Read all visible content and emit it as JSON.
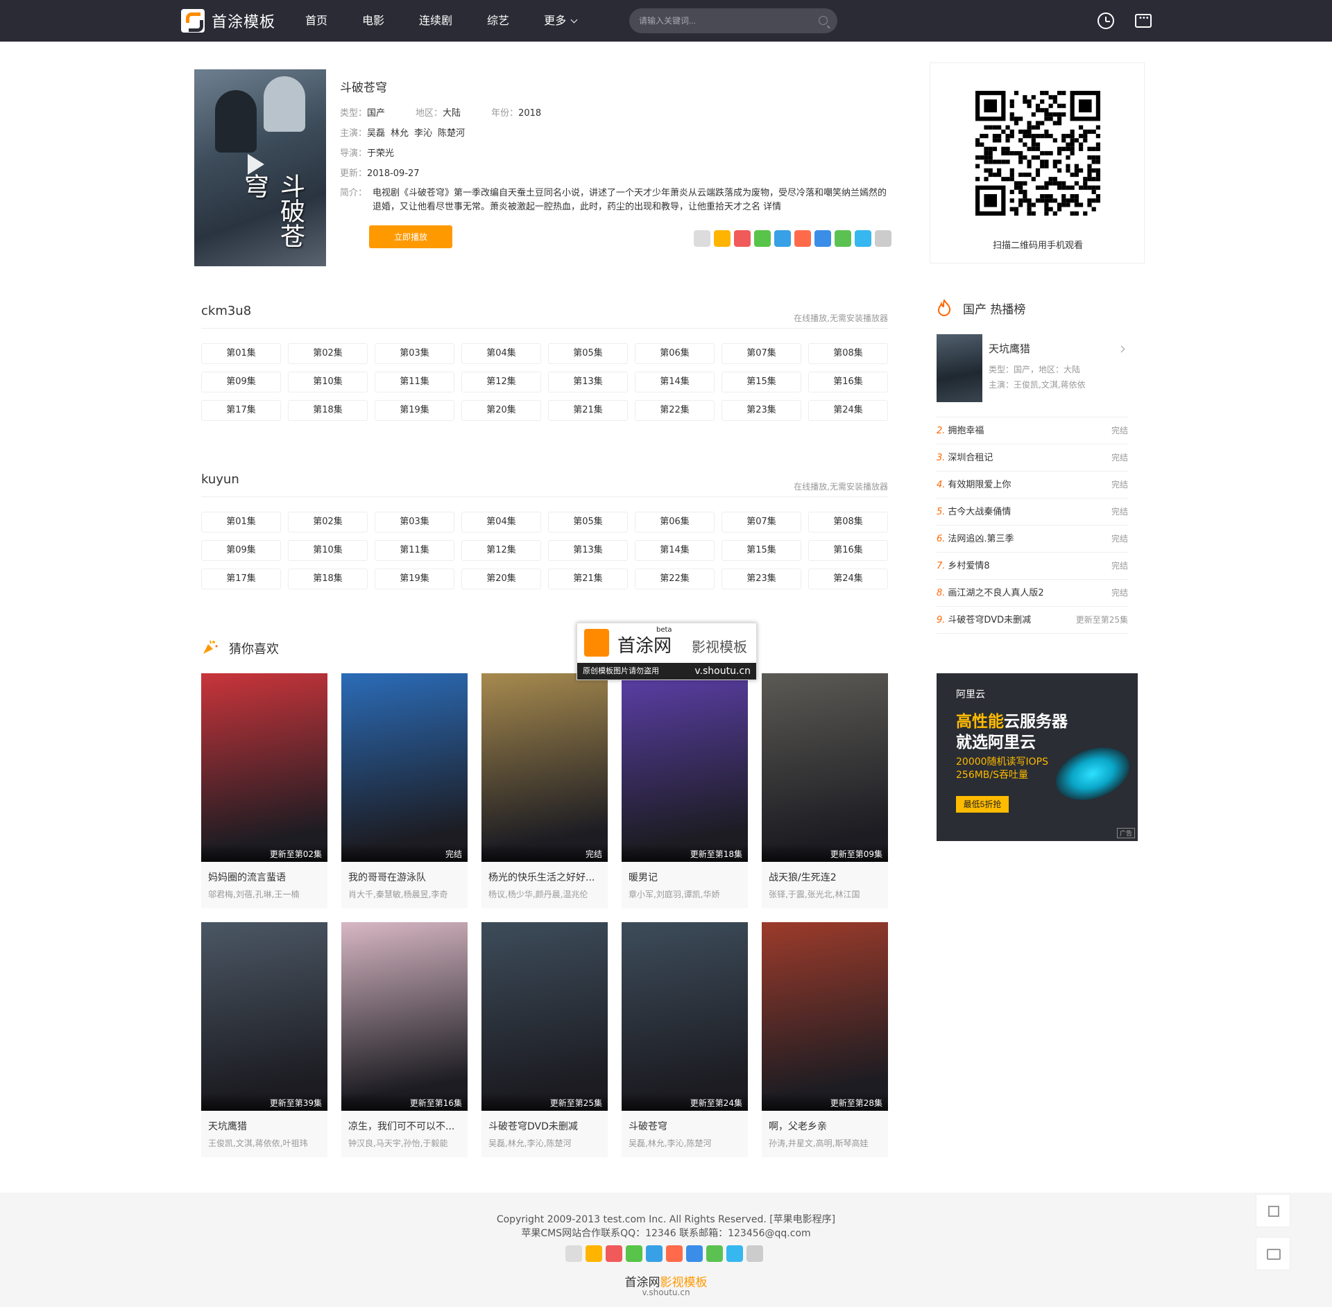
{
  "header": {
    "logo_text": "首涂模板",
    "nav": [
      "首页",
      "电影",
      "连续剧",
      "综艺",
      "更多"
    ],
    "search_placeholder": "请输入关键词..."
  },
  "video": {
    "title": "斗破苍穹",
    "type_label": "类型：",
    "type_value": "国产",
    "area_label": "地区：",
    "area_value": "大陆",
    "year_label": "年份：",
    "year_value": "2018",
    "actor_label": "主演：",
    "actors": [
      "吴磊",
      "林允",
      "李沁",
      "陈楚河"
    ],
    "director_label": "导演：",
    "director": "于荣光",
    "update_label": "更新：",
    "update": "2018-09-27",
    "desc_label": "简介：",
    "desc": "电视剧《斗破苍穹》第一季改编自天蚕土豆同名小说，讲述了一个天才少年萧炎从云端跌落成为废物，受尽冷落和嘲笑纳兰嫣然的退婚，又让他看尽世事无常。萧炎被激起一腔热血，此时，药尘的出现和教导，让他重拾天才之名",
    "desc_more": "详情",
    "play_button": "立即播放"
  },
  "qr": {
    "caption": "扫描二维码用手机观看"
  },
  "sources": [
    {
      "name": "ckm3u8",
      "note": "在线播放,无需安装播放器"
    },
    {
      "name": "kuyun",
      "note": "在线播放,无需安装播放器"
    }
  ],
  "episodes": [
    "第01集",
    "第02集",
    "第03集",
    "第04集",
    "第05集",
    "第06集",
    "第07集",
    "第08集",
    "第09集",
    "第10集",
    "第11集",
    "第12集",
    "第13集",
    "第14集",
    "第15集",
    "第16集",
    "第17集",
    "第18集",
    "第19集",
    "第20集",
    "第21集",
    "第22集",
    "第23集",
    "第24集"
  ],
  "guess": {
    "title": "猜你喜欢",
    "cards": [
      {
        "title": "妈妈圈的流言蜚语",
        "actors": "邬君梅,刘蓓,孔琳,王一楠",
        "badge": "更新至第02集",
        "color": "#c9353b"
      },
      {
        "title": "我的哥哥在游泳队",
        "actors": "肖大千,秦慧敏,杨晨昱,李奇",
        "badge": "完结",
        "color": "#2b6cb8"
      },
      {
        "title": "杨光的快乐生活之好好...",
        "actors": "杨议,杨少华,颜丹晨,温兆伦",
        "badge": "完结",
        "color": "#a78a4e"
      },
      {
        "title": "暖男记",
        "actors": "章小军,刘庭羽,谭凯,华娇",
        "badge": "更新至第18集",
        "color": "#5b3fa8"
      },
      {
        "title": "战天狼/生死连2",
        "actors": "张铎,于震,张光北,林江国",
        "badge": "更新至第09集",
        "color": "#5c5a54"
      },
      {
        "title": "天坑鹰猎",
        "actors": "王俊凯,文淇,蒋依依,叶祖玮",
        "badge": "更新至第39集",
        "color": "#4b5764"
      },
      {
        "title": "凉生，我们可不可以不...",
        "actors": "钟汉良,马天宇,孙怡,于毅能",
        "badge": "更新至第16集",
        "color": "#d7b7c3"
      },
      {
        "title": "斗破苍穹DVD未删减",
        "actors": "吴磊,林允,李沁,陈楚河",
        "badge": "更新至第25集",
        "color": "#3d4c5a"
      },
      {
        "title": "斗破苍穹",
        "actors": "吴磊,林允,李沁,陈楚河",
        "badge": "更新至第24集",
        "color": "#3d4c5a"
      },
      {
        "title": "啊，父老乡亲",
        "actors": "孙涛,井星文,高明,斯琴高娃",
        "badge": "更新至第28集",
        "color": "#9c3b2b"
      }
    ]
  },
  "watermark": {
    "name": "首涂网",
    "beta": "beta",
    "sub": "影视模板",
    "note": "原创模板图片请勿盗用",
    "url": "v.shoutu.cn"
  },
  "hot": {
    "title": "国产 热播榜",
    "top": {
      "title": "天坑鹰猎",
      "meta": "类型：国产，地区：大陆",
      "actors": "主演：王俊凯,文淇,蒋依依"
    },
    "items": [
      {
        "num": "2.",
        "title": "拥抱幸福",
        "status": "完结"
      },
      {
        "num": "3.",
        "title": "深圳合租记",
        "status": "完结"
      },
      {
        "num": "4.",
        "title": "有效期限爱上你",
        "status": "完结"
      },
      {
        "num": "5.",
        "title": "古今大战秦俑情",
        "status": "完结"
      },
      {
        "num": "6.",
        "title": "法网追凶.第三季",
        "status": "完结"
      },
      {
        "num": "7.",
        "title": "乡村爱情8",
        "status": "完结"
      },
      {
        "num": "8.",
        "title": "画江湖之不良人真人版2",
        "status": "完结"
      },
      {
        "num": "9.",
        "title": "斗破苍穹DVD未删减",
        "status": "更新至第25集"
      }
    ]
  },
  "ad": {
    "brand": "阿里云",
    "line1a": "高性能",
    "line1b": "云服务器",
    "line2": "就选阿里云",
    "spec1": "20000随机读写IOPS",
    "spec2": "256MB/S吞吐量",
    "button": "最低5折抢",
    "tag": "广告"
  },
  "footer": {
    "copyright": "Copyright 2009-2013 test.com Inc. All Rights Reserved. [苹果电影程序]",
    "contact": "苹果CMS网站合作联系QQ：12346 联系邮箱：123456@qq.com",
    "logo_a": "首涂网",
    "logo_b": "影视模板",
    "url": "v.shoutu.cn"
  },
  "share_colors": [
    "#dcdcdc",
    "#ffb400",
    "#f05a5a",
    "#58c449",
    "#38a0e6",
    "#ff6b4a",
    "#3a8ee8",
    "#5bc252",
    "#36b7f0",
    "#cccccc"
  ]
}
